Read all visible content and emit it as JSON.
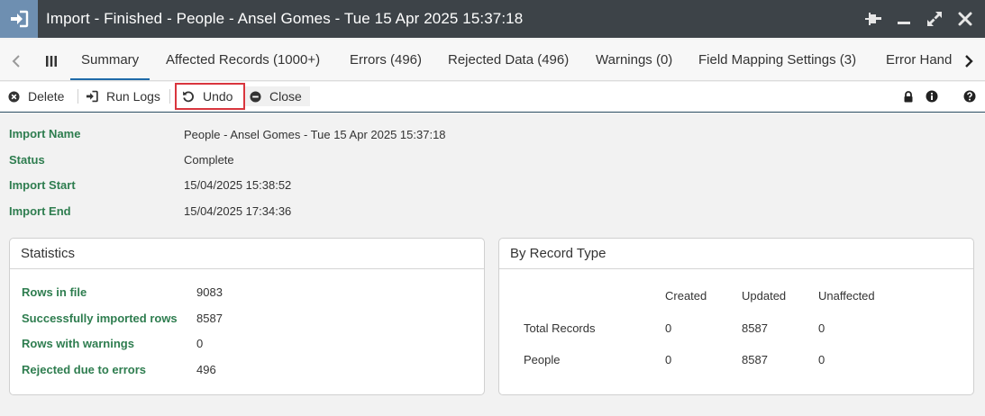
{
  "window": {
    "title": "Import - Finished - People - Ansel Gomes - Tue 15 Apr 2025 15:37:18",
    "app_icon": "sign-in-icon",
    "controls": [
      "pin-icon",
      "minimize-icon",
      "expand-icon",
      "close-icon"
    ]
  },
  "tabs": [
    {
      "label": "Summary",
      "active": true
    },
    {
      "label": "Affected Records (1000+)",
      "active": false
    },
    {
      "label": "Errors (496)",
      "active": false
    },
    {
      "label": "Rejected Data (496)",
      "active": false
    },
    {
      "label": "Warnings (0)",
      "active": false
    },
    {
      "label": "Field Mapping Settings (3)",
      "active": false
    },
    {
      "label": "Error Hand",
      "active": false
    }
  ],
  "toolbar": {
    "delete_label": "Delete",
    "run_logs_label": "Run Logs",
    "undo_label": "Undo",
    "close_label": "Close"
  },
  "info": {
    "import_name_label": "Import Name",
    "import_name_value": "People - Ansel Gomes - Tue 15 Apr 2025 15:37:18",
    "status_label": "Status",
    "status_value": "Complete",
    "start_label": "Import Start",
    "start_value": "15/04/2025 15:38:52",
    "end_label": "Import End",
    "end_value": "15/04/2025 17:34:36"
  },
  "statistics": {
    "title": "Statistics",
    "rows": [
      {
        "label": "Rows in file",
        "value": "9083"
      },
      {
        "label": "Successfully imported rows",
        "value": "8587"
      },
      {
        "label": "Rows with warnings",
        "value": "0"
      },
      {
        "label": "Rejected due to errors",
        "value": "496"
      }
    ]
  },
  "record_type": {
    "title": "By Record Type",
    "columns": [
      "Created",
      "Updated",
      "Unaffected"
    ],
    "rows": [
      {
        "name": "Total Records",
        "created": "0",
        "updated": "8587",
        "unaffected": "0"
      },
      {
        "name": "People",
        "created": "0",
        "updated": "8587",
        "unaffected": "0"
      }
    ]
  },
  "colors": {
    "titlebar": "#3d4348",
    "app_icon_bg": "#6e8fb1",
    "label_green": "#2e7d4f",
    "active_tab": "#1e6aa8",
    "highlight": "#d9363e"
  }
}
